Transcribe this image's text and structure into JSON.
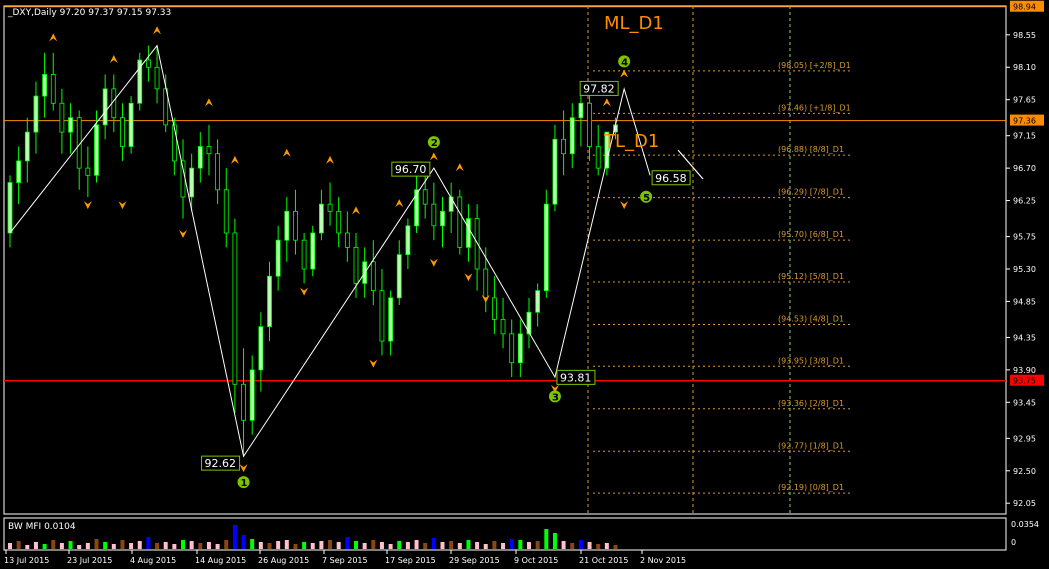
{
  "symbol_header": "_DXY,Daily  97.20 97.37 97.15 97.33",
  "indicator_header": "BW MFI 0.0104",
  "labels": {
    "ml": "ML_D1",
    "tl": "TL_D1"
  },
  "price_tags": {
    "top": "98.94",
    "current": "97.36",
    "support": "93.75"
  },
  "indicator_scale": [
    "0.0354",
    "0"
  ],
  "x_axis_labels": [
    "13 Jul 2015",
    "23 Jul 2015",
    "4 Aug 2015",
    "14 Aug 2015",
    "26 Aug 2015",
    "7 Sep 2015",
    "17 Sep 2015",
    "29 Sep 2015",
    "9 Oct 2015",
    "21 Oct 2015",
    "2 Nov 2015"
  ],
  "zigzag_points": [
    {
      "label": "92.62",
      "num": "1"
    },
    {
      "label": "96.70",
      "num": "2"
    },
    {
      "label": "93.81",
      "num": "3"
    },
    {
      "label": "97.82",
      "num": "4"
    },
    {
      "label": "96.58",
      "num": "5"
    }
  ],
  "colors": {
    "background": "#000000",
    "bull_candle": "#b8ffb0",
    "bear_candle": "#000000",
    "wick": "#00ff00",
    "zigzag": "#ffffff",
    "fib": "#d89a2e",
    "arrow": "#ff9900",
    "support_line": "#ff0000",
    "current_line": "#ff8c00",
    "number_circle": "#7cc400"
  },
  "chart_data": {
    "type": "candlestick",
    "title": "_DXY,Daily  97.20 97.37 97.15 97.33",
    "y_ticks": [
      "98.55",
      "98.10",
      "97.65",
      "97.15",
      "96.70",
      "96.25",
      "95.75",
      "95.30",
      "94.85",
      "94.35",
      "93.90",
      "93.45",
      "92.95",
      "92.50",
      "92.05"
    ],
    "y_range": [
      91.9,
      98.95
    ],
    "fib_levels": [
      {
        "label": "(98.05) [+2/8]_D1",
        "value": 98.05
      },
      {
        "label": "(97.46) [+1/8]_D1",
        "value": 97.46
      },
      {
        "label": "(96.88) [8/8]_D1",
        "value": 96.88
      },
      {
        "label": "(96.29) [7/8]_D1",
        "value": 96.29
      },
      {
        "label": "(95.70) [6/8]_D1",
        "value": 95.7
      },
      {
        "label": "(95.12) [5/8]_D1",
        "value": 95.12
      },
      {
        "label": "(94.53) [4/8]_D1",
        "value": 94.53
      },
      {
        "label": "(93.95) [3/8]_D1",
        "value": 93.95
      },
      {
        "label": "(93.36) [2/8]_D1",
        "value": 93.36
      },
      {
        "label": "(92.77) [1/8]_D1",
        "value": 92.77
      },
      {
        "label": "(92.19) [0/8]_D1",
        "value": 92.19
      }
    ],
    "candles": [
      [
        95.8,
        96.6,
        95.6,
        96.5
      ],
      [
        96.5,
        97.0,
        96.2,
        96.8
      ],
      [
        96.8,
        97.4,
        96.5,
        97.2
      ],
      [
        97.2,
        97.9,
        96.9,
        97.7
      ],
      [
        97.7,
        98.3,
        97.4,
        98.0
      ],
      [
        98.0,
        98.3,
        97.5,
        97.6
      ],
      [
        97.6,
        97.8,
        96.9,
        97.2
      ],
      [
        97.2,
        97.6,
        96.9,
        97.4
      ],
      [
        97.4,
        97.5,
        96.4,
        96.7
      ],
      [
        96.7,
        97.0,
        96.3,
        96.6
      ],
      [
        96.6,
        97.5,
        96.5,
        97.3
      ],
      [
        97.3,
        98.0,
        97.1,
        97.8
      ],
      [
        97.8,
        98.0,
        97.2,
        97.4
      ],
      [
        97.4,
        97.6,
        96.8,
        97.0
      ],
      [
        97.0,
        97.7,
        96.9,
        97.6
      ],
      [
        97.6,
        98.3,
        97.5,
        98.2
      ],
      [
        98.2,
        98.4,
        97.9,
        98.1
      ],
      [
        98.1,
        98.4,
        97.6,
        97.8
      ],
      [
        97.8,
        98.0,
        97.2,
        97.3
      ],
      [
        97.3,
        97.4,
        96.6,
        96.8
      ],
      [
        96.8,
        97.1,
        96.0,
        96.3
      ],
      [
        96.3,
        96.9,
        96.1,
        96.7
      ],
      [
        96.7,
        97.2,
        96.5,
        97.0
      ],
      [
        97.0,
        97.3,
        96.6,
        96.9
      ],
      [
        96.9,
        97.1,
        96.2,
        96.4
      ],
      [
        96.4,
        96.7,
        95.6,
        95.8
      ],
      [
        95.8,
        96.0,
        93.3,
        93.7
      ],
      [
        93.7,
        94.2,
        92.7,
        93.2
      ],
      [
        93.2,
        94.1,
        93.0,
        93.9
      ],
      [
        93.9,
        94.7,
        93.6,
        94.5
      ],
      [
        94.5,
        95.4,
        94.3,
        95.2
      ],
      [
        95.2,
        95.9,
        95.0,
        95.7
      ],
      [
        95.7,
        96.3,
        95.4,
        96.1
      ],
      [
        96.1,
        96.4,
        95.5,
        95.7
      ],
      [
        95.7,
        95.8,
        95.1,
        95.3
      ],
      [
        95.3,
        95.9,
        95.2,
        95.8
      ],
      [
        95.8,
        96.4,
        95.7,
        96.2
      ],
      [
        96.2,
        96.5,
        95.9,
        96.1
      ],
      [
        96.1,
        96.3,
        95.6,
        95.8
      ],
      [
        95.8,
        96.1,
        95.4,
        95.6
      ],
      [
        95.6,
        95.8,
        94.9,
        95.1
      ],
      [
        95.1,
        95.6,
        94.9,
        95.4
      ],
      [
        95.4,
        95.7,
        94.8,
        95.0
      ],
      [
        95.0,
        95.3,
        94.1,
        94.3
      ],
      [
        94.3,
        95.0,
        94.1,
        94.9
      ],
      [
        94.9,
        95.7,
        94.8,
        95.5
      ],
      [
        95.5,
        96.0,
        95.3,
        95.9
      ],
      [
        95.9,
        96.6,
        95.8,
        96.4
      ],
      [
        96.4,
        96.7,
        96.0,
        96.2
      ],
      [
        96.2,
        96.5,
        95.7,
        95.9
      ],
      [
        95.9,
        96.3,
        95.6,
        96.1
      ],
      [
        96.1,
        96.5,
        95.8,
        96.3
      ],
      [
        96.3,
        96.4,
        95.5,
        95.6
      ],
      [
        95.6,
        96.2,
        95.4,
        96.0
      ],
      [
        96.0,
        96.2,
        95.0,
        95.3
      ],
      [
        95.3,
        95.6,
        94.7,
        94.9
      ],
      [
        94.9,
        95.2,
        94.4,
        94.6
      ],
      [
        94.6,
        94.9,
        94.2,
        94.4
      ],
      [
        94.4,
        94.6,
        93.8,
        94.0
      ],
      [
        94.0,
        94.6,
        93.8,
        94.4
      ],
      [
        94.4,
        94.9,
        94.2,
        94.7
      ],
      [
        94.7,
        95.1,
        94.5,
        95.0
      ],
      [
        95.0,
        96.4,
        94.9,
        96.2
      ],
      [
        96.2,
        97.3,
        96.1,
        97.1
      ],
      [
        97.1,
        97.5,
        96.6,
        96.9
      ],
      [
        96.9,
        97.6,
        96.7,
        97.4
      ],
      [
        97.4,
        97.8,
        97.0,
        97.6
      ],
      [
        97.6,
        97.8,
        96.8,
        97.0
      ],
      [
        97.0,
        97.3,
        96.6,
        96.7
      ],
      [
        96.7,
        97.2,
        96.6,
        97.2
      ],
      [
        97.2,
        97.4,
        97.1,
        97.3
      ]
    ]
  }
}
